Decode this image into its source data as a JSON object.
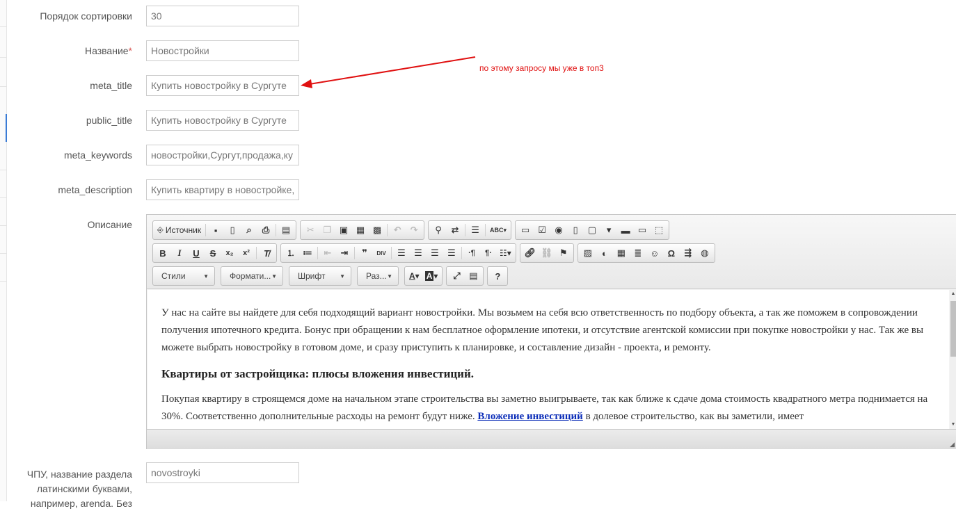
{
  "form": {
    "sort_order": {
      "label": "Порядок сортировки",
      "value": "30"
    },
    "name": {
      "label": "Название",
      "required_mark": "*",
      "value": "Новостройки"
    },
    "meta_title": {
      "label": "meta_title",
      "value": "Купить новостройку в Сургуте"
    },
    "public_title": {
      "label": "public_title",
      "value": "Купить новостройку в Сургуте"
    },
    "meta_keywords": {
      "label": "meta_keywords",
      "value": "новостройки,Сургут,продажа,ку"
    },
    "meta_description": {
      "label": "meta_description",
      "value": "Купить квартиру в новостройке,"
    },
    "description": {
      "label": "Описание"
    },
    "chpu": {
      "label": "ЧПУ, название раздела латинскими буквами, например, arenda. Без",
      "value": "novostroyki"
    }
  },
  "editor": {
    "source_label": "Источник",
    "combos": {
      "styles": "Стили",
      "format": "Формати...",
      "font": "Шрифт",
      "size": "Раз..."
    },
    "content": {
      "p1": "У нас на сайте вы найдете для себя подходящий вариант новостройки. Мы возьмем на себя всю ответственность по подбору объекта, а так же поможем в сопровождении получения ипотечного кредита. Бонус при обращении к нам бесплатное оформление ипотеки, и отсутствие агентской комиссии при покупке новостройки у нас. Так же вы можете выбрать новостройку в готовом доме, и сразу приступить к планировке, и составление дизайн - проекта, и ремонту.",
      "h3": "Квартиры от застройщика: плюсы вложения инвестиций.",
      "p2_before": "Покупая квартиру в строящемся доме  на начальном этапе строительства вы заметно выигрываете, так как ближе к сдаче дома стоимость квадратного метра поднимается на 30%. Соответственно  дополнительные расходы на ремонт будут ниже. ",
      "p2_link": "Вложение инвестиций",
      "p2_after": " в долевое строительство, как вы заметили, имеет"
    }
  },
  "annotation": {
    "text": "по этому запросу мы уже в топ3",
    "color": "#e01010"
  },
  "colors": {
    "link": "#0b2db8",
    "required": "#d9534f"
  }
}
